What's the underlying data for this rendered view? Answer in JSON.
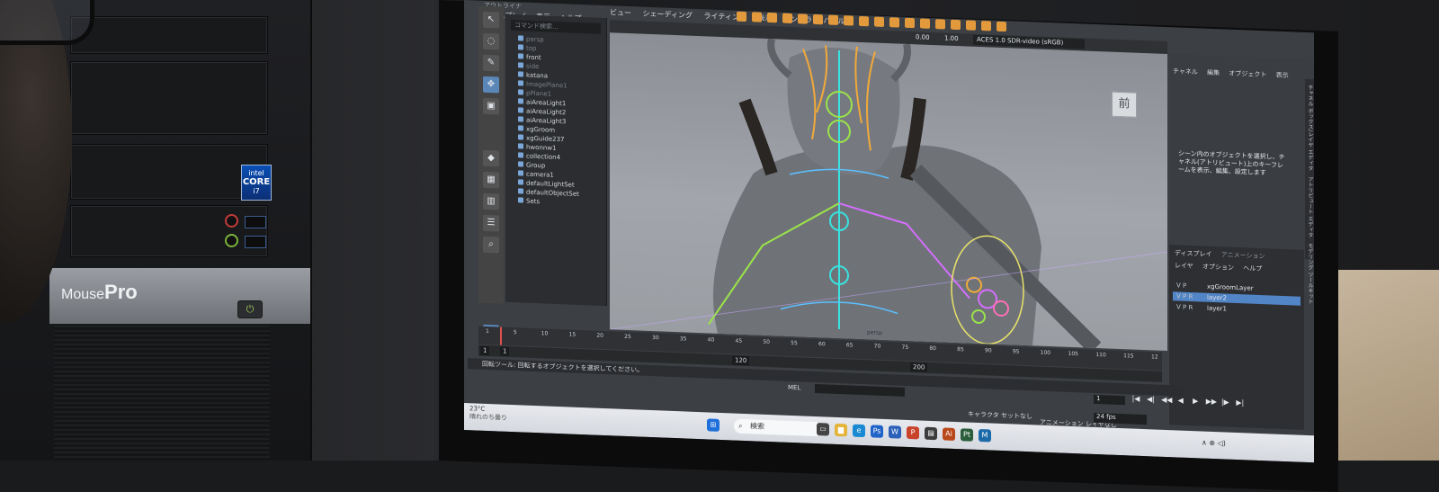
{
  "tower": {
    "brand_prefix": "Mouse",
    "brand_bold": "Pro",
    "cpu_badge_top": "intel",
    "cpu_badge_mid": "CORE",
    "cpu_badge_bottom": "i7"
  },
  "maya": {
    "menu": [
      "ディスプレイ",
      "表示",
      "ヘルプ"
    ],
    "outliner_header": "アウトライナ",
    "outliner_search": "コマンド検索...",
    "outliner_items": [
      {
        "label": "persp",
        "dim": true
      },
      {
        "label": "top",
        "dim": true
      },
      {
        "label": "front",
        "dim": false
      },
      {
        "label": "side",
        "dim": true
      },
      {
        "label": "katana",
        "dim": false
      },
      {
        "label": "ImagePlane1",
        "dim": true
      },
      {
        "label": "pPlane1",
        "dim": true
      },
      {
        "label": "aiAreaLight1",
        "dim": false
      },
      {
        "label": "aiAreaLight2",
        "dim": false
      },
      {
        "label": "aiAreaLight3",
        "dim": false
      },
      {
        "label": "xgGroom",
        "dim": false
      },
      {
        "label": "xgGuide237",
        "dim": false
      },
      {
        "label": "hwonnw1",
        "dim": false
      },
      {
        "label": "collection4",
        "dim": false
      },
      {
        "label": "Group",
        "dim": false
      },
      {
        "label": "camera1",
        "dim": false
      },
      {
        "label": "defaultLightSet",
        "dim": false
      },
      {
        "label": "defaultObjectSet",
        "dim": false
      },
      {
        "label": "Sets",
        "dim": false
      }
    ],
    "viewport_menu": [
      "ビュー",
      "シェーディング",
      "ライティング",
      "表示",
      "レンダラ",
      "パネル"
    ],
    "exposure_value": "0.00",
    "gamma_value": "1.00",
    "color_space": "ACES 1.0 SDR-video (sRGB)",
    "view_cube_label": "前",
    "persp_label": "persp",
    "channel_menu": [
      "チャネル",
      "編集",
      "オブジェクト",
      "表示"
    ],
    "channel_hint": "シーン内のオブジェクトを選択し、チャネル(アトリビュート)上のキーフレームを表示、編集、設定します",
    "side_tabs": [
      "チャネル ボックス/レイヤ エディタ",
      "アトリビュート エディタ",
      "モデリング ツールキット"
    ],
    "layer_tabs": {
      "display": "ディスプレイ",
      "animation": "アニメーション"
    },
    "layer_menu": [
      "レイヤ",
      "オプション",
      "ヘルプ"
    ],
    "layers": [
      {
        "flags": "V P",
        "name": "xgGroomLayer",
        "selected": false
      },
      {
        "flags": "V P R",
        "name": "layer2",
        "selected": true
      },
      {
        "flags": "V P R",
        "name": "layer1",
        "selected": false
      }
    ],
    "time_ticks": [
      "1",
      "5",
      "10",
      "15",
      "20",
      "25",
      "30",
      "35",
      "40",
      "45",
      "50",
      "55",
      "60",
      "65",
      "70",
      "75",
      "80",
      "85",
      "90",
      "95",
      "100",
      "105",
      "110",
      "115",
      "12"
    ],
    "range_start": "1",
    "range_start2": "1",
    "range_end": "120",
    "range_end2": "200",
    "current_frame": "1",
    "help_line": "回転ツール: 回転するオブジェクトを選択してください。",
    "command_label": "MEL",
    "character_set": "キャラクタ セットなし",
    "anim_layer": "アニメーション レイヤなし",
    "fps": "24 fps",
    "playback_buttons": [
      "|◀",
      "◀|",
      "◀◀",
      "◀",
      "▶",
      "▶▶",
      "|▶",
      "▶|"
    ]
  },
  "taskbar": {
    "search_label": "検索",
    "weather": "23°C",
    "weather_sub": "晴れのち曇り",
    "tray": "∧  ⊕  ◁) "
  },
  "colors": {
    "accent_selection": "#5285c6",
    "rig_green": "#9be34a",
    "rig_cyan": "#38e3e0",
    "rig_magenta": "#d66dff",
    "rig_orange": "#f1a93a"
  }
}
